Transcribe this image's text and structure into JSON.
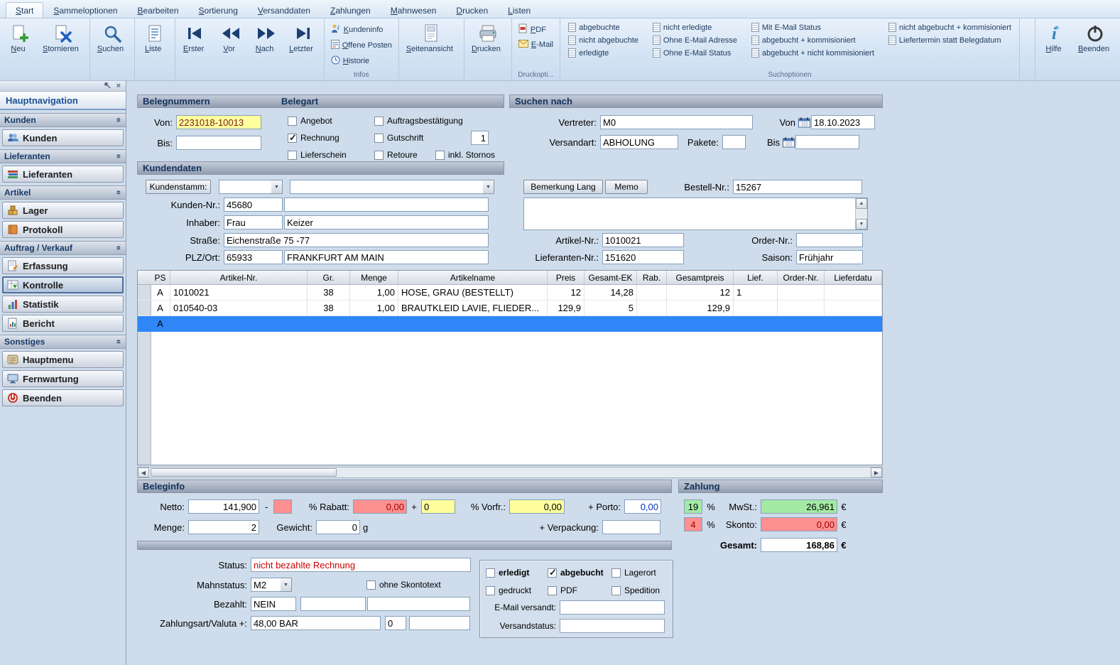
{
  "tabs": [
    {
      "label": "Start",
      "active": true
    },
    {
      "label": "Sammeloptionen"
    },
    {
      "label": "Bearbeiten"
    },
    {
      "label": "Sortierung"
    },
    {
      "label": "Versanddaten"
    },
    {
      "label": "Zahlungen"
    },
    {
      "label": "Mahnwesen"
    },
    {
      "label": "Drucken"
    },
    {
      "label": "Listen"
    }
  ],
  "ribbon": {
    "neu": "Neu",
    "stornieren": "Stornieren",
    "suchen": "Suchen",
    "liste": "Liste",
    "erster": "Erster",
    "vor": "Vor",
    "nach": "Nach",
    "letzter": "Letzter",
    "infos": {
      "group_label": "Infos",
      "kundeninfo": "Kundeninfo",
      "offene_posten": "Offene Posten",
      "historie": "Historie"
    },
    "seitenansicht": "Seitenansicht",
    "drucken": "Drucken",
    "druck": {
      "group_label": "Druckopti...",
      "pdf": "PDF",
      "email": "E-Mail"
    },
    "suchoptionen": {
      "group_label": "Suchoptionen",
      "col1": [
        "abgebuchte",
        "nicht abgebuchte",
        "erledigte"
      ],
      "col2": [
        "nicht erledigte",
        "Ohne E-Mail Adresse",
        "Ohne E-Mail Status"
      ],
      "col3": [
        "Mit E-Mail Status",
        "abgebucht + kommisioniert",
        "abgebucht + nicht kommisioniert"
      ],
      "col4": [
        "nicht abgebucht + kommisioniert",
        "Liefertermin statt Belegdatum"
      ]
    },
    "hilfe": "Hilfe",
    "beenden": "Beenden"
  },
  "sidebar": {
    "title": "Hauptnavigation",
    "sections": [
      {
        "header": "Kunden",
        "items": [
          {
            "label": "Kunden"
          }
        ]
      },
      {
        "header": "Lieferanten",
        "items": [
          {
            "label": "Lieferanten"
          }
        ]
      },
      {
        "header": "Artikel",
        "items": [
          {
            "label": "Lager"
          },
          {
            "label": "Protokoll"
          }
        ]
      },
      {
        "header": "Auftrag / Verkauf",
        "items": [
          {
            "label": "Erfassung"
          },
          {
            "label": "Kontrolle",
            "selected": true
          },
          {
            "label": "Statistik"
          },
          {
            "label": "Bericht"
          }
        ]
      },
      {
        "header": "Sonstiges",
        "items": [
          {
            "label": "Hauptmenu"
          },
          {
            "label": "Fernwartung"
          },
          {
            "label": "Beenden"
          }
        ]
      }
    ]
  },
  "form": {
    "belegnummern": {
      "title": "Belegnummern",
      "von_label": "Von:",
      "von_value": "2231018-10013",
      "bis_label": "Bis:",
      "bis_value": ""
    },
    "belegart": {
      "title": "Belegart",
      "items": [
        {
          "label": "Angebot",
          "checked": false
        },
        {
          "label": "Rechnung",
          "checked": true
        },
        {
          "label": "Lieferschein",
          "checked": false
        },
        {
          "label": "Auftragsbestätigung",
          "checked": false
        },
        {
          "label": "Gutschrift",
          "checked": false
        },
        {
          "label": "Retoure",
          "checked": false
        },
        {
          "label": "inkl. Stornos",
          "checked": false
        }
      ],
      "gutschrift_count": "1"
    },
    "suchen_nach": {
      "title": "Suchen nach",
      "vertreter_label": "Vertreter:",
      "vertreter_value": "M0",
      "versandart_label": "Versandart:",
      "versandart_value": "ABHOLUNG",
      "pakete_label": "Pakete:",
      "pakete_value": "",
      "von_label": "Von",
      "von_value": "18.10.2023",
      "bis_label": "Bis",
      "bis_value": ""
    },
    "kundendaten": {
      "title": "Kundendaten",
      "kundenstamm_label": "Kundenstamm:",
      "kunden_nr_label": "Kunden-Nr.:",
      "kunden_nr_value": "45680",
      "kunden_name_value": "",
      "inhaber_label": "Inhaber:",
      "anrede_value": "Frau",
      "name_value": "Keizer",
      "strasse_label": "Straße:",
      "strasse_value": "Eichenstraße 75 -77",
      "plz_ort_label": "PLZ/Ort:",
      "plz_value": "65933",
      "ort_value": "FRANKFURT AM MAIN"
    },
    "bestellinfo": {
      "bemerkung_btn": "Bemerkung Lang",
      "memo_btn": "Memo",
      "bestell_nr_label": "Bestell-Nr.:",
      "bestell_nr_value": "15267",
      "memo_value": "",
      "artikel_nr_label": "Artikel-Nr.:",
      "artikel_nr_value": "1010021",
      "order_nr_label": "Order-Nr.:",
      "order_nr_value": "",
      "lieferanten_nr_label": "Lieferanten-Nr.:",
      "lieferanten_nr_value": "151620",
      "saison_label": "Saison:",
      "saison_value": "Frühjahr"
    }
  },
  "table": {
    "columns": [
      "PS",
      "Artikel-Nr.",
      "Gr.",
      "Menge",
      "Artikelname",
      "Preis",
      "Gesamt-EK",
      "Rab.",
      "Gesamtpreis",
      "Lief.",
      "Order-Nr.",
      "Lieferdatu"
    ],
    "rows": [
      [
        "A",
        "1010021",
        "38",
        "1,00",
        "HOSE, GRAU (BESTELLT)",
        "12",
        "14,28",
        "",
        "12",
        "1",
        "",
        ""
      ],
      [
        "A",
        "010540-03",
        "38",
        "1,00",
        "BRAUTKLEID LAVIE, FLIEDER...",
        "129,9",
        "5",
        "",
        "129,9",
        "",
        "",
        ""
      ],
      [
        "A",
        "",
        "",
        "",
        "",
        "",
        "",
        "",
        "",
        "",
        "",
        ""
      ]
    ],
    "selected_row_index": 2
  },
  "beleginfo": {
    "title": "Beleginfo",
    "netto_label": "Netto:",
    "netto_value": "141,900",
    "minus": "-",
    "rabatt_box_value": "",
    "rabatt_label": "% Rabatt:",
    "rabatt_value": "0,00",
    "plus": "+",
    "zuschlag_value": "0",
    "vorfr_label": "% Vorfr.:",
    "vorfr_value": "0,00",
    "porto_label": "+ Porto:",
    "porto_value": "0,00",
    "menge_label": "Menge:",
    "menge_value": "2",
    "gewicht_label": "Gewicht:",
    "gewicht_value": "0",
    "gewicht_unit": "g",
    "verpackung_label": "+ Verpackung:",
    "verpackung_value": ""
  },
  "zahlung": {
    "title": "Zahlung",
    "mwst_pct": "19",
    "percent": "%",
    "mwst_label": "MwSt.:",
    "mwst_value": "26,961",
    "euro": "€",
    "skonto_pct": "4",
    "skonto_label": "Skonto:",
    "skonto_value": "0,00",
    "gesamt_label": "Gesamt:",
    "gesamt_value": "168,86"
  },
  "status_area": {
    "status_label": "Status:",
    "status_value": "nicht bezahlte Rechnung",
    "mahnstatus_label": "Mahnstatus:",
    "mahnstatus_value": "M2",
    "ohne_skontotext": {
      "label": "ohne Skontotext",
      "checked": false
    },
    "bezahlt_label": "Bezahlt:",
    "bezahlt_value": "NEIN",
    "bezahlt_extra1": "",
    "bezahlt_extra2": "",
    "zahlungsart_label": "Zahlungsart/Valuta +:",
    "zahlungsart_value": "48,00 BAR",
    "valuta_value": "0",
    "zahlungsart_extra": "",
    "flags": [
      {
        "label": "erledigt",
        "checked": false
      },
      {
        "label": "abgebucht",
        "checked": true
      },
      {
        "label": "Lagerort",
        "checked": false
      },
      {
        "label": "gedruckt",
        "checked": false
      },
      {
        "label": "PDF",
        "checked": false
      },
      {
        "label": "Spedition",
        "checked": false
      }
    ],
    "email_versandt_label": "E-Mail versandt:",
    "email_versandt_value": "",
    "versandstatus_label": "Versandstatus:",
    "versandstatus_value": ""
  },
  "colors": {
    "selection_blue": "#2f86f6",
    "field_yellow": "#ffff9e",
    "field_red": "#ff9090",
    "field_green": "#a4eaa4",
    "status_text_red": "#cc0000"
  }
}
